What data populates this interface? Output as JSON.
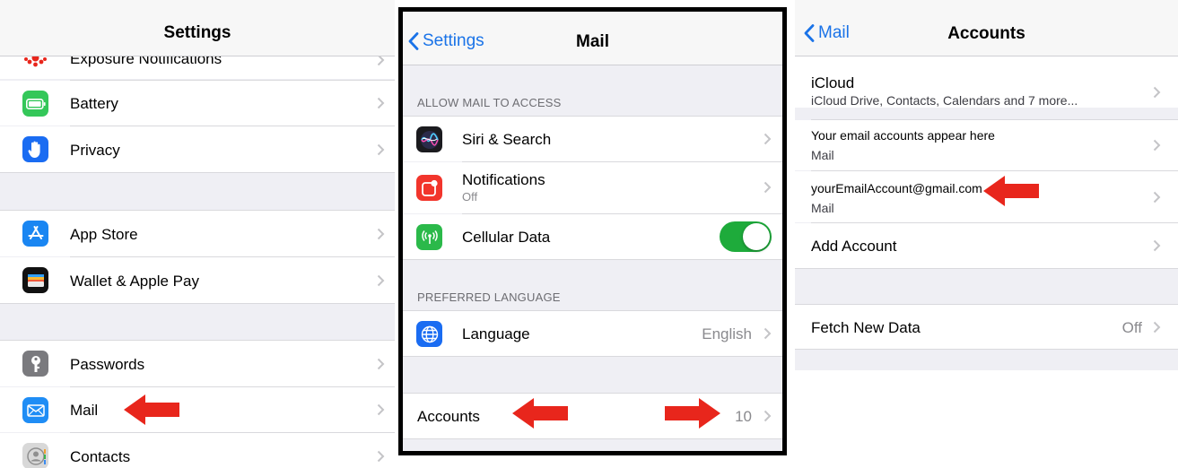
{
  "settings_panel": {
    "title": "Settings",
    "items": [
      {
        "label": "Exposure Notifications",
        "icon": "exposure-icon"
      },
      {
        "label": "Battery",
        "icon": "battery-icon"
      },
      {
        "label": "Privacy",
        "icon": "hand-icon"
      },
      {
        "label": "App Store",
        "icon": "app-store-icon"
      },
      {
        "label": "Wallet & Apple Pay",
        "icon": "wallet-icon"
      },
      {
        "label": "Passwords",
        "icon": "key-icon"
      },
      {
        "label": "Mail",
        "icon": "mail-icon"
      },
      {
        "label": "Contacts",
        "icon": "contacts-icon"
      }
    ]
  },
  "mail_panel": {
    "back_label": "Settings",
    "title": "Mail",
    "section_access_header": "ALLOW MAIL TO ACCESS",
    "siri_label": "Siri & Search",
    "notifications_label": "Notifications",
    "notifications_sub": "Off",
    "cellular_label": "Cellular Data",
    "cellular_on": true,
    "section_language_header": "PREFERRED LANGUAGE",
    "language_label": "Language",
    "language_value": "English",
    "accounts_label": "Accounts",
    "accounts_value": "10"
  },
  "accounts_panel": {
    "back_label": "Mail",
    "title": "Accounts",
    "icloud_label": "iCloud",
    "icloud_sub": "iCloud Drive, Contacts, Calendars and 7 more...",
    "placeholder_label": "Your email accounts appear here",
    "placeholder_sub": "Mail",
    "gmail_label": "yourEmailAccount@gmail.com",
    "gmail_sub": "Mail",
    "add_account_label": "Add Account",
    "fetch_label": "Fetch New Data",
    "fetch_value": "Off"
  },
  "colors": {
    "accent_blue": "#1a73e8",
    "arrow_red": "#e8261c",
    "toggle_green": "#1eab3b",
    "group_bg": "#efeff4"
  }
}
